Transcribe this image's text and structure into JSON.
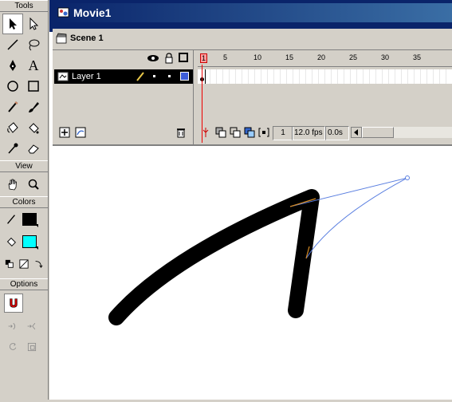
{
  "tools_panel": {
    "header": "Tools",
    "tools": [
      {
        "name": "arrow-tool",
        "selected": true
      },
      {
        "name": "subselect-tool"
      },
      {
        "name": "line-tool"
      },
      {
        "name": "lasso-tool"
      },
      {
        "name": "pen-tool"
      },
      {
        "name": "text-tool",
        "glyph": "A"
      },
      {
        "name": "oval-tool"
      },
      {
        "name": "rectangle-tool"
      },
      {
        "name": "pencil-tool"
      },
      {
        "name": "brush-tool"
      },
      {
        "name": "ink-bottle-tool"
      },
      {
        "name": "paint-bucket-tool"
      },
      {
        "name": "dropper-tool"
      },
      {
        "name": "eraser-tool"
      }
    ],
    "view_header": "View",
    "colors_header": "Colors",
    "stroke_color": "#000000",
    "fill_color": "#00ffff",
    "options_header": "Options"
  },
  "document": {
    "title": "Movie1",
    "scene_label": "Scene 1",
    "layer_name": "Layer 1",
    "ruler_numbers": [
      "1",
      "5",
      "10",
      "15",
      "20",
      "25",
      "30",
      "35"
    ],
    "current_frame": "1",
    "frame_rate": "12.0 fps",
    "elapsed_time": "0.0s"
  },
  "colors": {
    "title_bar": "#0a246a",
    "layer_outline_color": "#3c5cd8",
    "bezier_handle": "#5a7fe0"
  }
}
